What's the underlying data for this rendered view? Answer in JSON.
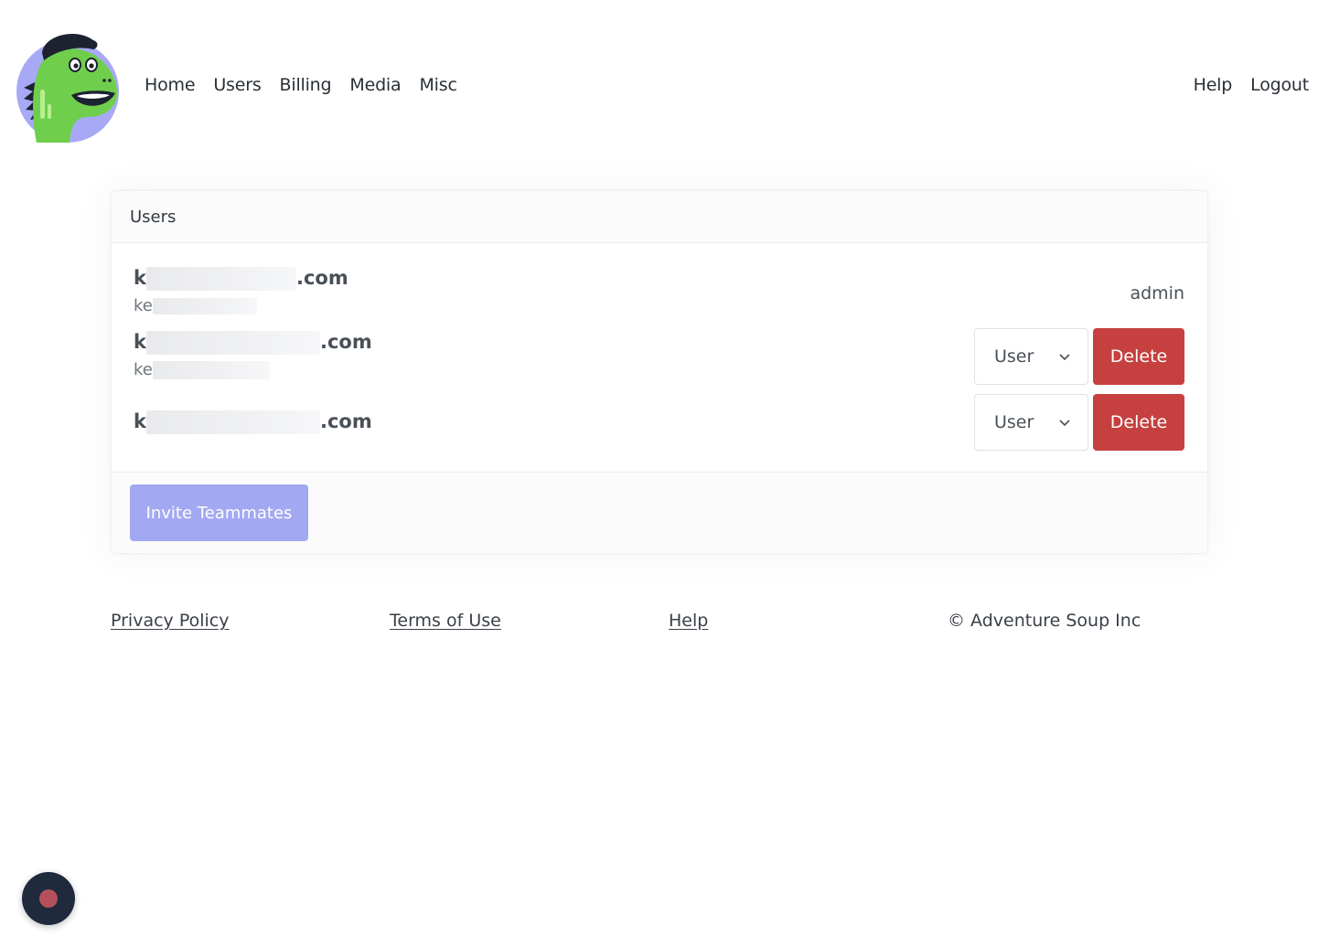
{
  "nav": {
    "left": [
      "Home",
      "Users",
      "Billing",
      "Media",
      "Misc"
    ],
    "right": [
      "Help",
      "Logout"
    ]
  },
  "card": {
    "title": "Users",
    "users": [
      {
        "email_prefix": "k",
        "email_suffix": ".com",
        "name_prefix": "ke",
        "role_text": "admin"
      },
      {
        "email_prefix": "k",
        "email_suffix": ".com",
        "name_prefix": "ke",
        "role_select": "User",
        "delete_label": "Delete"
      },
      {
        "email_prefix": "k",
        "email_suffix": ".com",
        "role_select": "User",
        "delete_label": "Delete"
      }
    ],
    "invite_label": "Invite Teammates"
  },
  "footer": {
    "privacy": "Privacy Policy",
    "terms": "Terms of Use",
    "help": "Help",
    "copyright": "© Adventure Soup Inc"
  },
  "colors": {
    "delete": "#c6403f",
    "invite": "#a3a8f2",
    "logo_circle": "#a7a9f6",
    "dino_green": "#6fcf4c"
  },
  "icons": {
    "logo": "dinosaur-mascot-logo",
    "select_arrow": "chevron-down-icon",
    "widget": "record-icon"
  }
}
